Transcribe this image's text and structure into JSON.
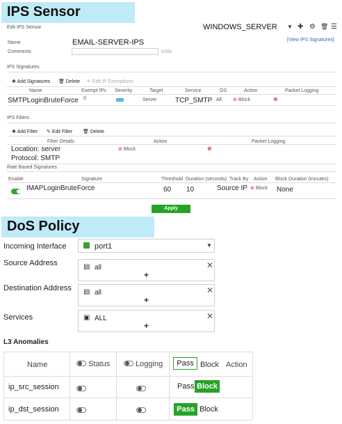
{
  "ips": {
    "header": "IPS Sensor",
    "edit_label": "Edit IPS Sensor",
    "sensor_select": "WINDOWS_SERVER",
    "view_link": "[View IPS Signatures]",
    "name_label": "Name",
    "name_value": "EMAIL-SERVER-IPS",
    "comments_label": "Comments",
    "comments_counter": "0/255",
    "signatures_section": "IPS Signatures",
    "add_signatures": "Add Signatures",
    "delete": "Delete",
    "edit_exemption": "Edit IP Exemptions",
    "sig_cols": [
      "Name",
      "Exempt IPs",
      "Severity",
      "Target",
      "Service",
      "OS",
      "Action",
      "Packet Logging"
    ],
    "sig_row": {
      "name": "SMTPLoginBruteForce",
      "exempt": "0",
      "target": "Server",
      "service": "TCP_SMTP",
      "os": "All",
      "action": "Block"
    },
    "filters_section": "IPS Filters",
    "add_filter": "Add Filter",
    "edit_filter": "Edit Filter",
    "filter_delete": "Delete",
    "filter_cols": [
      "Filter Details",
      "Action",
      "Packet Logging"
    ],
    "filter_row": {
      "location": "Location: server",
      "protocol": "Protocol: SMTP",
      "action": "Block"
    },
    "rate_section": "Rate Based Signatures",
    "rate_cols": [
      "Enable",
      "Signature",
      "Threshold",
      "Duration (seconds)",
      "Track By",
      "Action",
      "Block Duration (minutes)"
    ],
    "rate_row": {
      "signature": "IMAPLoginBruteForce",
      "threshold": "60",
      "duration": "10",
      "track": "Source IP",
      "action": "Block",
      "block_duration": "None"
    },
    "apply": "Apply"
  },
  "dos": {
    "header": "DoS Policy",
    "incoming_label": "Incoming Interface",
    "incoming_value": "port1",
    "source_label": "Source Address",
    "source_value": "all",
    "dest_label": "Destination Address",
    "dest_value": "all",
    "services_label": "Services",
    "services_value": "ALL",
    "anomalies_title": "L3 Anomalies",
    "cols": {
      "name": "Name",
      "status": "Status",
      "logging": "Logging",
      "pass": "Pass",
      "block": "Block",
      "action": "Action"
    },
    "rows": [
      {
        "name": "ip_src_session",
        "pass": "Pass",
        "block": "Block"
      },
      {
        "name": "ip_dst_session",
        "pass": "Pass",
        "block": "Block"
      }
    ]
  },
  "colors": {
    "header_bg": "#bfeaf7",
    "accent_green": "#27a327"
  }
}
